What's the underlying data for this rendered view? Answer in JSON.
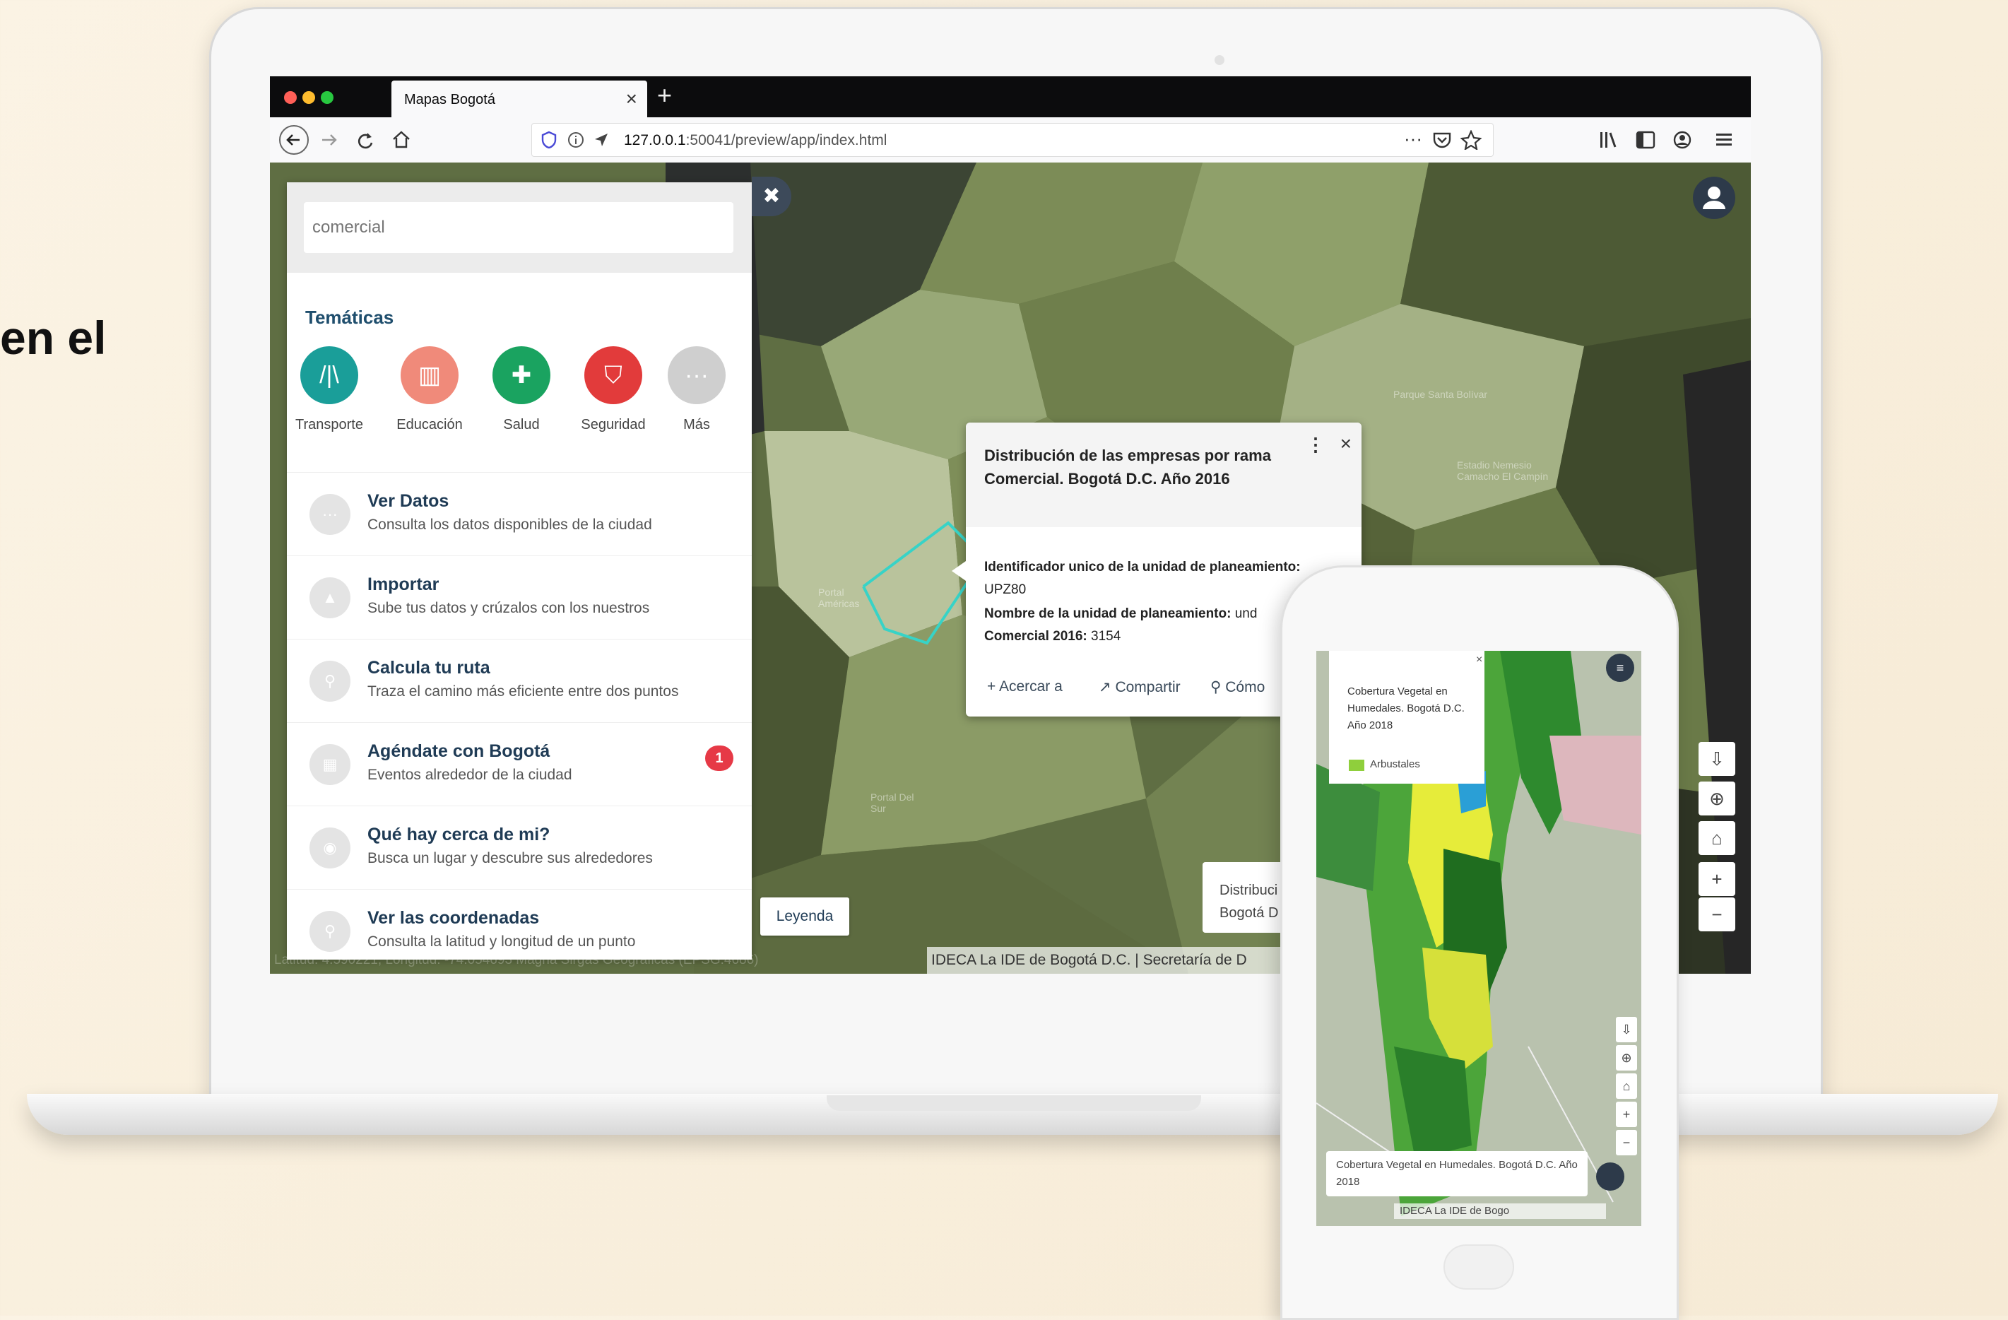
{
  "background_text": "en el",
  "browser": {
    "tab_title": "Mapas Bogotá",
    "tab_close": "×",
    "new_tab": "+",
    "url_host": "127.0.0.1",
    "url_rest": ":50041/preview/app/index.html",
    "dots": [
      "#ff5f57",
      "#febc2e",
      "#28c840"
    ]
  },
  "panel": {
    "search_placeholder": "comercial",
    "tematicas_title": "Temáticas",
    "tematicas": [
      {
        "label": "Transporte",
        "color": "#1a9e99",
        "icon": "road-icon",
        "glyph": "/|\\"
      },
      {
        "label": "Educación",
        "color": "#f08a7a",
        "icon": "book-icon",
        "glyph": "▥"
      },
      {
        "label": "Salud",
        "color": "#1aa360",
        "icon": "medkit-icon",
        "glyph": "✚"
      },
      {
        "label": "Seguridad",
        "color": "#e23b3b",
        "icon": "shield-icon",
        "glyph": "⛉"
      },
      {
        "label": "Más",
        "color": "#cfcfcf",
        "icon": "more-icon",
        "glyph": "···"
      }
    ],
    "items": [
      {
        "title": "Ver Datos",
        "subtitle": "Consulta los datos disponibles de la ciudad",
        "icon": "dots-icon",
        "glyph": "···"
      },
      {
        "title": "Importar",
        "subtitle": "Sube tus datos y crúzalos con los nuestros",
        "icon": "upload-icon",
        "glyph": "▲"
      },
      {
        "title": "Calcula tu ruta",
        "subtitle": "Traza el camino más eficiente entre dos puntos",
        "icon": "route-icon",
        "glyph": "⚲"
      },
      {
        "title": "Agéndate con Bogotá",
        "subtitle": "Eventos alrededor de la ciudad",
        "icon": "calendar-icon",
        "glyph": "▦",
        "badge": "1"
      },
      {
        "title": "Qué hay cerca de mi?",
        "subtitle": "Busca un lugar y descubre sus alrededores",
        "icon": "nearby-icon",
        "glyph": "◉"
      },
      {
        "title": "Ver las coordenadas",
        "subtitle": "Consulta la latitud y longitud de un punto",
        "icon": "pin-icon",
        "glyph": "⚲"
      }
    ]
  },
  "popup": {
    "title": "Distribución de las empresas por rama Comercial. Bogotá D.C. Año 2016",
    "field1_label": "Identificador unico de la unidad de planeamiento:",
    "field1_value": "UPZ80",
    "field2_label": "Nombre de la unidad de planeamiento:",
    "field2_value": "und",
    "field3_label": "Comercial 2016:",
    "field3_value": "3154",
    "actions": [
      "Acercar a",
      "Compartir",
      "Cómo"
    ]
  },
  "map": {
    "leyenda": "Leyenda",
    "distrib_line1": "Distribuci",
    "distrib_line2": "Bogotá D",
    "status": "Latitud: 4.590221, Longitud: -74.054693 Magna Sirgas Geográficas (EPSG:4686)",
    "attribution": "IDECA La IDE de Bogotá D.C. | Secretaría de D",
    "labels": [
      "Parque Santa Bolívar",
      "Estadio Nemesio Camacho El Campín",
      "Portal Américas",
      "Portal Del Sur"
    ],
    "controls": [
      "⇩",
      "⊕",
      "⌂",
      "+",
      "−"
    ]
  },
  "phone": {
    "popup_title": "Cobertura Vegetal en Humedales. Bogotá D.C. Año 2018",
    "popup_legend": "Arbustales",
    "legend_text": "Cobertura Vegetal en Humedales. Bogotá D.C. Año 2018",
    "attribution": "IDECA La IDE de Bogo",
    "controls": [
      "⇩",
      "⊕",
      "⌂",
      "+",
      "−"
    ]
  },
  "colors": {
    "map_dark": "#3f4a2c",
    "map_mid": "#6f7f4c",
    "map_light": "#97a772",
    "highlight": "#37d3c7",
    "title_blue": "#1f4e6d"
  }
}
